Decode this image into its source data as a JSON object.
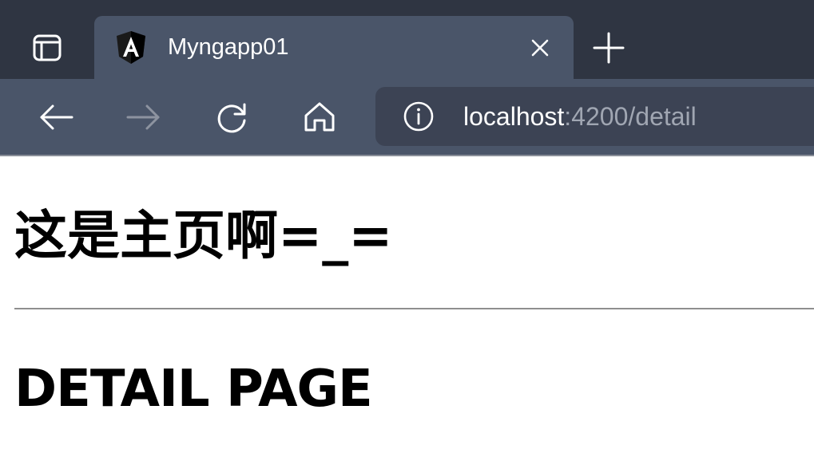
{
  "browser": {
    "tab": {
      "title": "Myngapp01",
      "favicon": "angular-logo-icon"
    },
    "address_bar": {
      "host": "localhost",
      "rest": ":4200/detail"
    },
    "icons": {
      "tab_actions": "tab-actions-icon",
      "close": "close-icon",
      "new_tab": "plus-icon",
      "back": "arrow-left-icon",
      "forward": "arrow-right-icon",
      "refresh": "refresh-icon",
      "home": "home-icon",
      "site_info": "info-icon"
    },
    "colors": {
      "tabstrip": "#2f3542",
      "active_tab": "#4a5569",
      "address_bar": "#3c4354",
      "url_muted": "#a0a6b2"
    }
  },
  "page": {
    "home_heading": "这是主页啊=_=",
    "detail_heading": "DETAIL PAGE"
  }
}
